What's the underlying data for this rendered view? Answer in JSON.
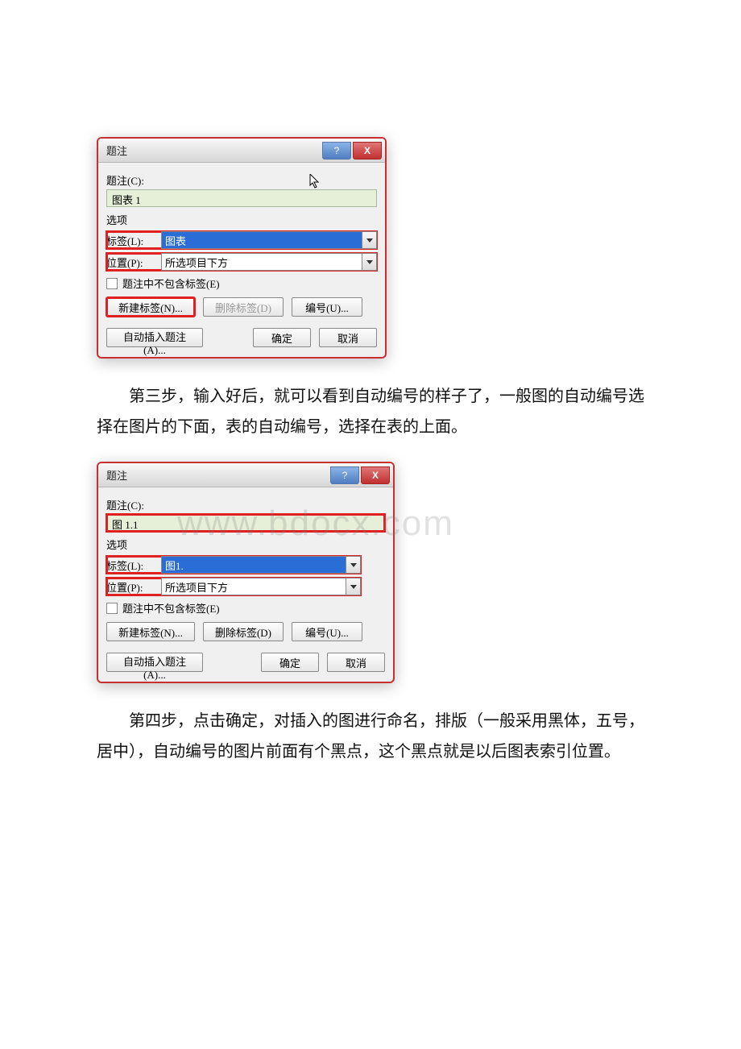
{
  "dialog1": {
    "title": "题注",
    "captionLabel": "题注(C):",
    "captionText": "图表 1",
    "optionsTitle": "选项",
    "labelField": "标签(L):",
    "labelValue": "图表",
    "positionField": "位置(P):",
    "positionValue": "所选项目下方",
    "excludeLabel": "题注中不包含标签(E)",
    "newLabelBtn": "新建标签(N)...",
    "deleteLabelBtn": "删除标签(D)",
    "numberingBtn": "编号(U)...",
    "autoBtn": "自动插入题注(A)...",
    "ok": "确定",
    "cancel": "取消",
    "helpGlyph": "?",
    "closeGlyph": "X"
  },
  "para3": "第三步，输入好后，就可以看到自动编号的样子了，一般图的自动编号选择在图片的下面，表的自动编号，选择在表的上面。",
  "dialog2": {
    "title": "题注",
    "captionLabel": "题注(C):",
    "captionText": "图 1.1",
    "optionsTitle": "选项",
    "labelField": "标签(L):",
    "labelValue": "图1.",
    "positionField": "位置(P):",
    "positionValue": "所选项目下方",
    "excludeLabel": "题注中不包含标签(E)",
    "newLabelBtn": "新建标签(N)...",
    "deleteLabelBtn": "删除标签(D)",
    "numberingBtn": "编号(U)...",
    "autoBtn": "自动插入题注(A)...",
    "ok": "确定",
    "cancel": "取消",
    "helpGlyph": "?",
    "closeGlyph": "X"
  },
  "para4": "第四步，点击确定，对插入的图进行命名，排版（一般采用黑体，五号，居中），自动编号的图片前面有个黑点，这个黑点就是以后图表索引位置。",
  "watermark": "www.bdocx.com"
}
